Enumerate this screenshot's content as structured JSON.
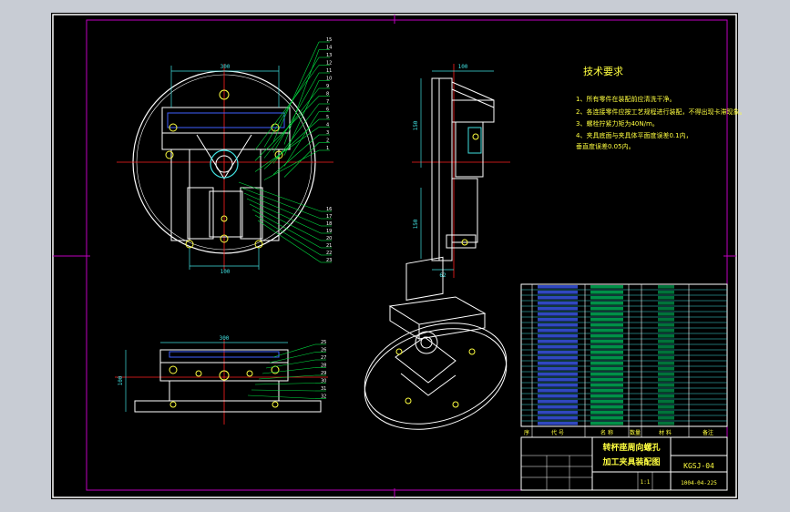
{
  "colors": {
    "background_frame": "#c8ccd4",
    "paper": "#000000",
    "border_magenta": "#c000c0",
    "linework_white": "#ffffff",
    "centerline_red": "#ff2020",
    "dimension_cyan": "#40e0e0",
    "leader_green": "#00e040",
    "part_blue": "#4060ff",
    "note_yellow": "#ffff40"
  },
  "technical_requirements": {
    "title": "技术要求",
    "items": [
      "1、所有零件在装配前应清洗干净。",
      "2、各连接零件应按工艺规程进行装配，不得出现卡滞现象。",
      "3、螺栓拧紧力矩为40N/m。",
      "4、夹具底面与夹具体平面度误差0.1内，",
      "   垂直度误差0.05内。"
    ]
  },
  "title_block": {
    "drawing_title_line1": "转杯座周向螺孔",
    "drawing_title_line2": "加工夹具装配图",
    "drawing_code": "KGSJ-04",
    "drawing_number": "1004-04-225",
    "header_cells": [
      "序",
      "代 号",
      "名 称",
      "数量",
      "材 料",
      "备注"
    ],
    "scale": "1:1"
  },
  "leader_numbers_top_view": [
    "15",
    "14",
    "13",
    "12",
    "11",
    "10",
    "9",
    "8",
    "7",
    "6",
    "5",
    "4",
    "3",
    "2",
    "1"
  ],
  "leader_numbers_top_view_lower": [
    "16",
    "17",
    "18",
    "19",
    "20",
    "21",
    "22",
    "23"
  ],
  "leader_numbers_front_view": [
    "25",
    "26",
    "27",
    "28",
    "29",
    "30",
    "31",
    "32"
  ],
  "dimensions": {
    "top_width": "300",
    "top_bottom": "100",
    "side_width": "100",
    "side_height_upper": "150",
    "side_height_lower": "150",
    "side_bottom": "62",
    "front_width": "300",
    "front_height": "100"
  }
}
